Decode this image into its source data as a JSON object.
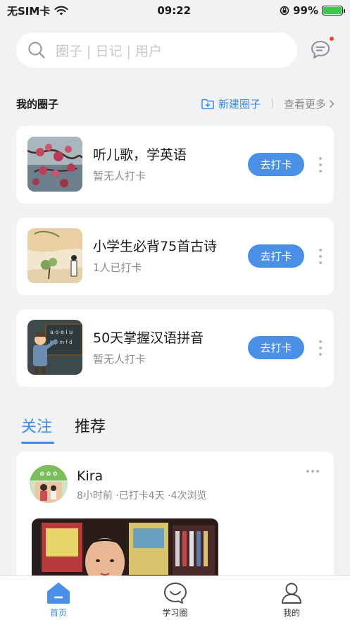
{
  "status_bar": {
    "carrier": "无SIM卡",
    "time": "09:22",
    "battery": "99%",
    "icons": [
      "wifi-icon",
      "orientation-lock-icon",
      "battery-icon"
    ]
  },
  "search": {
    "placeholder": "圈子 | 日记 | 用户",
    "icon": "search-icon"
  },
  "messages": {
    "icon": "message-icon",
    "badge_color": "#f0402f"
  },
  "my_circles": {
    "title": "我的圈子",
    "new_label": "新建圈子",
    "more_label": "查看更多",
    "items": [
      {
        "name": "听儿歌，学英语",
        "status": "暂无人打卡",
        "button": "去打卡"
      },
      {
        "name": "小学生必背75首古诗",
        "status": "1人已打卡",
        "button": "去打卡"
      },
      {
        "name": "50天掌握汉语拼音",
        "status": "暂无人打卡",
        "button": "去打卡"
      }
    ]
  },
  "tabs": [
    {
      "label": "关注",
      "active": true
    },
    {
      "label": "推荐",
      "active": false
    }
  ],
  "feed": {
    "username": "Kira",
    "meta": "8小时前 ·已打卡4天 ·4次浏览"
  },
  "bottom_nav": [
    {
      "label": "首页",
      "icon": "home-icon",
      "active": true
    },
    {
      "label": "学习圈",
      "icon": "chat-bubble-icon",
      "active": false
    },
    {
      "label": "我的",
      "icon": "profile-icon",
      "active": false
    }
  ],
  "colors": {
    "accent": "#3b8be5",
    "button": "#4a90e6",
    "background": "#f1f2f4"
  }
}
